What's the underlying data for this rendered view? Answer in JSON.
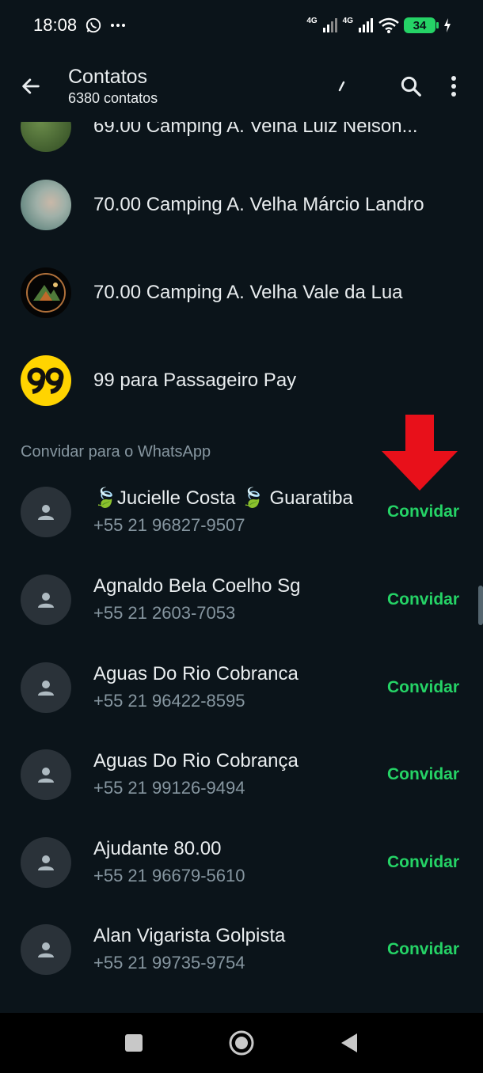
{
  "status_bar": {
    "time": "18:08",
    "battery": "34",
    "network1": "4G",
    "network2": "4G"
  },
  "app_bar": {
    "title": "Contatos",
    "subtitle": "6380 contatos"
  },
  "contacts": [
    {
      "name": "69.00 Camping A. Velha Luiz Nelson..."
    },
    {
      "name": "70.00 Camping A. Velha Márcio Landro"
    },
    {
      "name": "70.00 Camping A. Velha Vale da Lua"
    },
    {
      "name": "99 para Passageiro Pay"
    }
  ],
  "invite_section": {
    "header": "Convidar para o WhatsApp",
    "invite_label": "Convidar",
    "items": [
      {
        "name": "🍃Jucielle Costa 🍃 Guaratiba",
        "phone": "+55 21 96827-9507"
      },
      {
        "name": "Agnaldo Bela Coelho Sg",
        "phone": "+55 21 2603-7053"
      },
      {
        "name": "Aguas Do Rio Cobranca",
        "phone": "+55 21 96422-8595"
      },
      {
        "name": "Aguas Do Rio Cobrança",
        "phone": "+55 21 99126-9494"
      },
      {
        "name": "Ajudante 80.00",
        "phone": "+55 21 96679-5610"
      },
      {
        "name": "Alan Vigarista Golpista",
        "phone": "+55 21 99735-9754"
      }
    ]
  },
  "colors": {
    "background": "#0b141a",
    "accent": "#25d366",
    "annotation_arrow": "#e8101a"
  },
  "icons": [
    "back-arrow-icon",
    "search-icon",
    "more-vert-icon",
    "person-icon",
    "whatsapp-icon",
    "square-icon",
    "circle-icon",
    "triangle-back-icon"
  ]
}
